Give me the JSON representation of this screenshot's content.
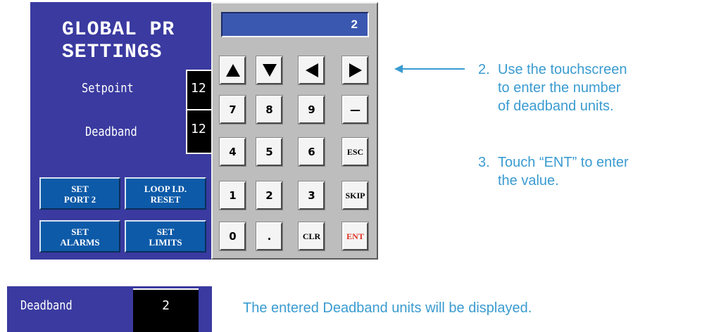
{
  "screen": {
    "title_line1": "GLOBAL PR",
    "title_line2": "SETTINGS",
    "setpoint_label": "Setpoint",
    "setpoint_value": "12",
    "deadband_label": "Deadband",
    "deadband_value": "12",
    "buttons": [
      {
        "line1": "SET",
        "line2": "PORT 2"
      },
      {
        "line1": "LOOP I.D.",
        "line2": "RESET"
      },
      {
        "line1": "SET",
        "line2": "ALARMS"
      },
      {
        "line1": "SET",
        "line2": "LIMITS"
      }
    ]
  },
  "keypad": {
    "display_value": "2",
    "arrows": [
      "up-arrow",
      "down-arrow",
      "left-arrow",
      "right-arrow"
    ],
    "keys": {
      "k7": "7",
      "k8": "8",
      "k9": "9",
      "minus": "—",
      "k4": "4",
      "k5": "5",
      "k6": "6",
      "esc": "ESC",
      "k1": "1",
      "k2": "2",
      "k3": "3",
      "skip": "SKIP",
      "k0": "0",
      "dot": ".",
      "clr": "CLR",
      "ent": "ENT"
    },
    "ent_color": "#e03020"
  },
  "instructions": {
    "step2_num": "2.",
    "step2_line1": "Use the touchscreen",
    "step2_line2": "to enter the number",
    "step2_line3": "of deadband units.",
    "step3_num": "3.",
    "step3_line1": "Touch “ENT” to enter",
    "step3_line2": "the value."
  },
  "result": {
    "label": "Deadband",
    "value": "2",
    "caption": "The entered Deadband units will be displayed."
  },
  "colors": {
    "hmi_background": "#3a3aa0",
    "accent": "#3a9bd0",
    "soft_button": "#0d5aa8"
  }
}
